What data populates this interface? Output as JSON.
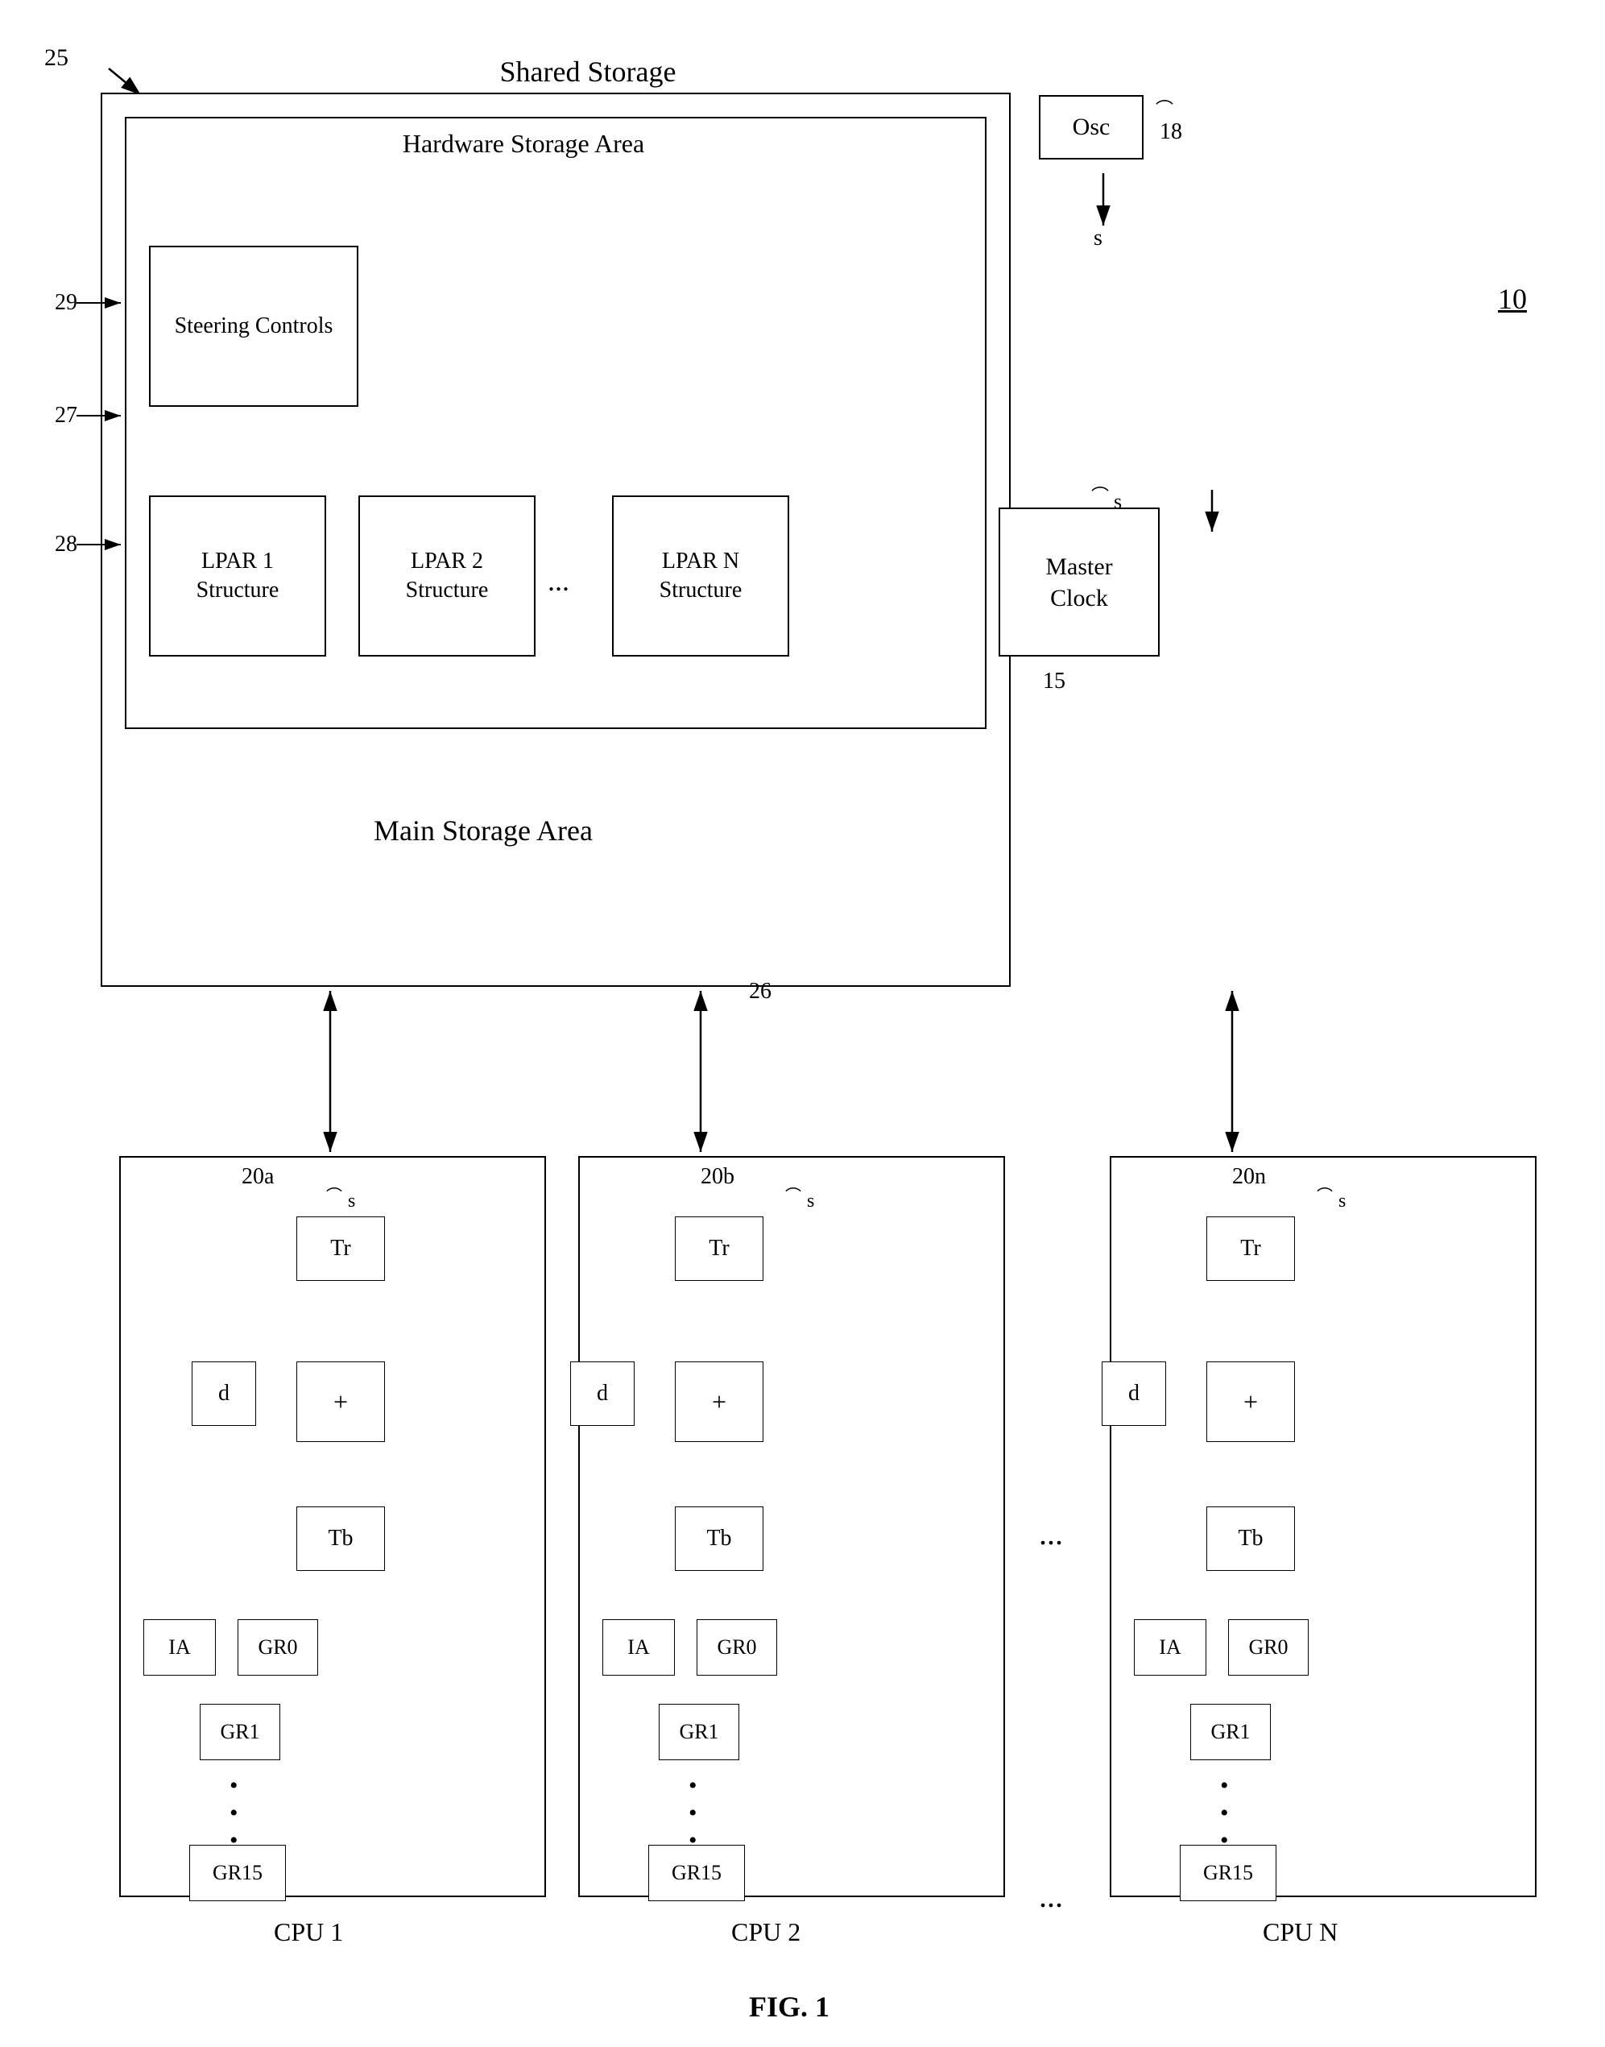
{
  "title": "FIG. 1",
  "diagram_number": "25",
  "diagram_number_label": "10",
  "shared_storage_label": "Shared Storage",
  "hardware_area_label": "Hardware Storage Area",
  "main_storage_label": "Main Storage Area",
  "steering_controls_label": "Steering Controls",
  "lpar1_label": "LPAR 1\nStructure",
  "lpar2_label": "LPAR 2\nStructure",
  "lparn_label": "LPAR N\nStructure",
  "master_clock_label": "Master\nClock",
  "osc_label": "Osc",
  "ref_numbers": {
    "n25": "25",
    "n27": "27",
    "n28": "28",
    "n29": "29",
    "n18": "18",
    "n15": "15",
    "n26": "26",
    "n20a": "20a",
    "n20b": "20b",
    "n20n": "20n"
  },
  "cpu_labels": {
    "cpu1": "CPU 1",
    "cpu2": "CPU 2",
    "cpun": "CPU N"
  },
  "cpu_inner": {
    "tr": "Tr",
    "d": "d",
    "plus": "+",
    "tb": "Tb",
    "ia": "IA",
    "gr0": "GR0",
    "gr1": "GR1",
    "gr15": "GR15",
    "s": "s"
  },
  "dots": "...",
  "fig_label": "FIG. 1"
}
